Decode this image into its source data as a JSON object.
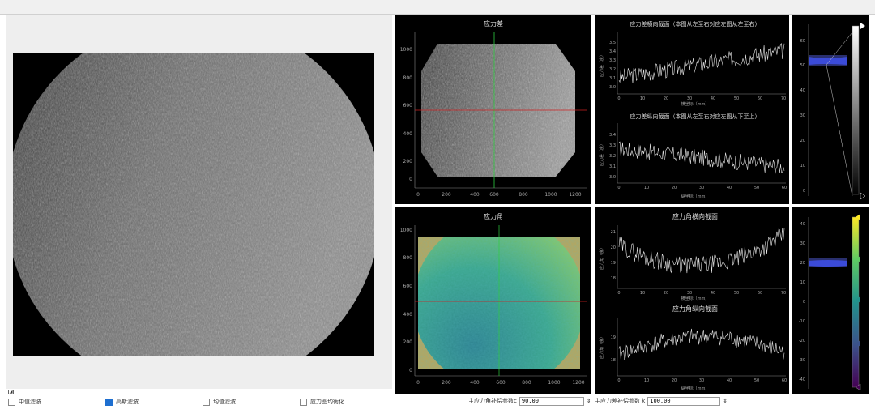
{
  "panels": {
    "top_map_title": "应力差",
    "bottom_map_title": "应力角",
    "top_h_section_title": "应力差横向截面（本图从左至右对应左图从左至右）",
    "top_v_section_title": "应力差纵向截面（本图从左至右对应左图从下至上）",
    "bottom_h_section_title": "应力角横向截面",
    "bottom_v_section_title": "应力角纵向截面"
  },
  "axes": {
    "map_x_ticks": [
      "0",
      "200",
      "400",
      "600",
      "800",
      "1000",
      "1200"
    ],
    "top_map_y_ticks": [
      "1000",
      "800",
      "600",
      "400",
      "200",
      "0"
    ],
    "bottom_map_y_ticks": [
      "1000",
      "800",
      "600",
      "400",
      "200",
      "0"
    ],
    "top_section_x_ticks": [
      "0",
      "10",
      "20",
      "30",
      "40",
      "50",
      "60",
      "70"
    ],
    "top_v_section_x_ticks": [
      "0",
      "10",
      "20",
      "30",
      "40",
      "50",
      "60"
    ],
    "top_h_section_y_ticks": [
      "3.5",
      "3.4",
      "3.3",
      "3.2",
      "3.1",
      "3.0"
    ],
    "top_v_section_y_ticks": [
      "3.4",
      "3.3",
      "3.2",
      "3.1",
      "3.0"
    ],
    "bottom_h_section_y_ticks": [
      "21",
      "20",
      "19",
      "18"
    ],
    "bottom_v_section_y_ticks": [
      "19",
      "18"
    ],
    "bottom_section_x_ticks": [
      "0",
      "10",
      "20",
      "30",
      "40",
      "50",
      "60",
      "70"
    ],
    "bottom_v_section_x_ticks": [
      "0",
      "10",
      "20",
      "30",
      "40",
      "50",
      "60"
    ],
    "h_section_xlabel": "横坐标（mm）",
    "v_section_xlabel": "纵坐标（mm）",
    "top_section_ylabel": "应力差（度）",
    "bottom_section_ylabel": "应力角（度）",
    "top_colorbar_ticks": [
      "60",
      "50",
      "40",
      "30",
      "20",
      "10",
      "0"
    ],
    "bottom_colorbar_ticks": [
      "40",
      "30",
      "20",
      "10",
      "0",
      "-10",
      "-20",
      "-30",
      "-40"
    ]
  },
  "controls": {
    "median_filter_label": "中值滤波",
    "median_filter_checked": false,
    "gauss_filter_label": "高斯滤波",
    "gauss_filter_checked": true,
    "mean_filter_label": "均值滤波",
    "mean_filter_checked": false,
    "stress_unify_label": "应力图均衡化",
    "stress_unify_checked": false,
    "angle_comp_label": "主应力角补偿参数c",
    "angle_comp_value": "90.00",
    "diff_comp_label": "主应力差补偿参数 k",
    "diff_comp_value": "100.00"
  },
  "colors": {
    "viridis_top": "#fde725",
    "viridis_mid": "#21918c",
    "viridis_bottom": "#440154",
    "crosshair_v": "#2ecc40",
    "crosshair_h": "#cc2222",
    "checkbox_checked": "#1e6fd0"
  }
}
